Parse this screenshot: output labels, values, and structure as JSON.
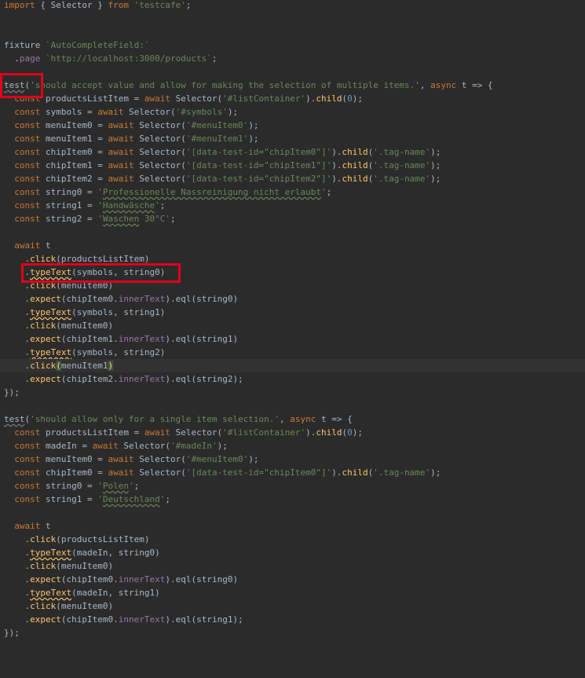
{
  "editor": {
    "language": "javascript",
    "background": "#2b2b2b",
    "lines": [
      [
        [
          "kw",
          "import"
        ],
        [
          "p",
          " { Selector } "
        ],
        [
          "kw",
          "from"
        ],
        [
          "p",
          " "
        ],
        [
          "str",
          "'testcafe'"
        ],
        [
          "p",
          ";"
        ]
      ],
      [],
      [],
      [
        [
          "p",
          "fixture "
        ],
        [
          "str",
          "`AutoCompleteField:`"
        ]
      ],
      [
        [
          "p",
          "  ."
        ],
        [
          "prop",
          "page"
        ],
        [
          "p",
          " "
        ],
        [
          "str",
          "`http://localhost:3000/products`"
        ],
        [
          "p",
          ";"
        ]
      ],
      [],
      [
        [
          "testname",
          "test"
        ],
        [
          "p",
          "("
        ],
        [
          "str",
          "'should accept value and allow for making the selection of multiple items.'"
        ],
        [
          "p",
          ", "
        ],
        [
          "kw",
          "async"
        ],
        [
          "p",
          " t => {"
        ]
      ],
      [
        [
          "p",
          "  "
        ],
        [
          "kw",
          "const"
        ],
        [
          "p",
          " productsListItem = "
        ],
        [
          "kw",
          "await"
        ],
        [
          "p",
          " Selector("
        ],
        [
          "str",
          "'#listContainer'"
        ],
        [
          "p",
          ")."
        ],
        [
          "method",
          "child"
        ],
        [
          "p",
          "("
        ],
        [
          "num",
          "0"
        ],
        [
          "p",
          ");"
        ]
      ],
      [
        [
          "p",
          "  "
        ],
        [
          "kw",
          "const"
        ],
        [
          "p",
          " symbols = "
        ],
        [
          "kw",
          "await"
        ],
        [
          "p",
          " Selector("
        ],
        [
          "str",
          "'#symbols'"
        ],
        [
          "p",
          ");"
        ]
      ],
      [
        [
          "p",
          "  "
        ],
        [
          "kw",
          "const"
        ],
        [
          "p",
          " menuItem0 = "
        ],
        [
          "kw",
          "await"
        ],
        [
          "p",
          " Selector("
        ],
        [
          "str",
          "'#menuItem0'"
        ],
        [
          "p",
          ");"
        ]
      ],
      [
        [
          "p",
          "  "
        ],
        [
          "kw",
          "const"
        ],
        [
          "p",
          " menuItem1 = "
        ],
        [
          "kw",
          "await"
        ],
        [
          "p",
          " Selector("
        ],
        [
          "str",
          "'#menuItem1'"
        ],
        [
          "p",
          ");"
        ]
      ],
      [
        [
          "p",
          "  "
        ],
        [
          "kw",
          "const"
        ],
        [
          "p",
          " chipItem0 = "
        ],
        [
          "kw",
          "await"
        ],
        [
          "p",
          " Selector("
        ],
        [
          "str",
          "'[data-test-id=\"chipItem0\"]'"
        ],
        [
          "p",
          ")."
        ],
        [
          "method",
          "child"
        ],
        [
          "p",
          "("
        ],
        [
          "str",
          "'.tag-name'"
        ],
        [
          "p",
          ");"
        ]
      ],
      [
        [
          "p",
          "  "
        ],
        [
          "kw",
          "const"
        ],
        [
          "p",
          " chipItem1 = "
        ],
        [
          "kw",
          "await"
        ],
        [
          "p",
          " Selector("
        ],
        [
          "str",
          "'[data-test-id=\"chipItem1\"]'"
        ],
        [
          "p",
          ")."
        ],
        [
          "method",
          "child"
        ],
        [
          "p",
          "("
        ],
        [
          "str",
          "'.tag-name'"
        ],
        [
          "p",
          ");"
        ]
      ],
      [
        [
          "p",
          "  "
        ],
        [
          "kw",
          "const"
        ],
        [
          "p",
          " chipItem2 = "
        ],
        [
          "kw",
          "await"
        ],
        [
          "p",
          " Selector("
        ],
        [
          "str",
          "'[data-test-id=\"chipItem2\"]'"
        ],
        [
          "p",
          ")."
        ],
        [
          "method",
          "child"
        ],
        [
          "p",
          "("
        ],
        [
          "str",
          "'.tag-name'"
        ],
        [
          "p",
          ");"
        ]
      ],
      [
        [
          "p",
          "  "
        ],
        [
          "kw",
          "const"
        ],
        [
          "p",
          " string0 = "
        ],
        [
          "str",
          "'"
        ],
        [
          "strU",
          "Professionelle Nassreinigung nicht erlaubt"
        ],
        [
          "str",
          "'"
        ],
        [
          "p",
          ";"
        ]
      ],
      [
        [
          "p",
          "  "
        ],
        [
          "kw",
          "const"
        ],
        [
          "p",
          " string1 = "
        ],
        [
          "str",
          "'"
        ],
        [
          "strU",
          "Handwäsche"
        ],
        [
          "str",
          "'"
        ],
        [
          "p",
          ";"
        ]
      ],
      [
        [
          "p",
          "  "
        ],
        [
          "kw",
          "const"
        ],
        [
          "p",
          " string2 = "
        ],
        [
          "str",
          "'"
        ],
        [
          "strU",
          "Waschen"
        ],
        [
          "str",
          " 30°C'"
        ],
        [
          "p",
          ";"
        ]
      ],
      [],
      [
        [
          "p",
          "  "
        ],
        [
          "kw",
          "await"
        ],
        [
          "p",
          " t"
        ]
      ],
      [
        [
          "p",
          "    ."
        ],
        [
          "method",
          "click"
        ],
        [
          "p",
          "(productsListItem)"
        ]
      ],
      [
        [
          "p",
          "    ."
        ],
        [
          "methodU",
          "typeText"
        ],
        [
          "p",
          "(symbols, string0)"
        ]
      ],
      [
        [
          "p",
          "    ."
        ],
        [
          "method",
          "click"
        ],
        [
          "p",
          "(menuItem0)"
        ]
      ],
      [
        [
          "p",
          "    ."
        ],
        [
          "method",
          "expect"
        ],
        [
          "p",
          "(chipItem0."
        ],
        [
          "prop",
          "innerText"
        ],
        [
          "p",
          ")."
        ],
        [
          "p",
          "eql(string0)"
        ]
      ],
      [
        [
          "p",
          "    ."
        ],
        [
          "methodU",
          "typeText"
        ],
        [
          "p",
          "(symbols, string1)"
        ]
      ],
      [
        [
          "p",
          "    ."
        ],
        [
          "method",
          "click"
        ],
        [
          "p",
          "(menuItem0)"
        ]
      ],
      [
        [
          "p",
          "    ."
        ],
        [
          "method",
          "expect"
        ],
        [
          "p",
          "(chipItem1."
        ],
        [
          "prop",
          "innerText"
        ],
        [
          "p",
          ")."
        ],
        [
          "p",
          "eql(string1)"
        ]
      ],
      [
        [
          "p",
          "    ."
        ],
        [
          "methodU",
          "typeText"
        ],
        [
          "p",
          "(symbols, string2)"
        ]
      ],
      [
        [
          "p",
          "    ."
        ],
        [
          "method",
          "click"
        ],
        [
          "bm",
          "("
        ],
        [
          "p",
          "menuItem1"
        ],
        [
          "bm",
          ")"
        ]
      ],
      [
        [
          "p",
          "    ."
        ],
        [
          "method",
          "expect"
        ],
        [
          "p",
          "(chipItem2."
        ],
        [
          "prop",
          "innerText"
        ],
        [
          "p",
          ")."
        ],
        [
          "p",
          "eql(string2);"
        ]
      ],
      [
        [
          "p",
          "});"
        ]
      ],
      [],
      [
        [
          "testname",
          "test"
        ],
        [
          "p",
          "("
        ],
        [
          "str",
          "'should allow only for a single item selection.'"
        ],
        [
          "p",
          ", "
        ],
        [
          "kw",
          "async"
        ],
        [
          "p",
          " t => {"
        ]
      ],
      [
        [
          "p",
          "  "
        ],
        [
          "kw",
          "const"
        ],
        [
          "p",
          " productsListItem = "
        ],
        [
          "kw",
          "await"
        ],
        [
          "p",
          " Selector("
        ],
        [
          "str",
          "'#listContainer'"
        ],
        [
          "p",
          ")."
        ],
        [
          "method",
          "child"
        ],
        [
          "p",
          "("
        ],
        [
          "num",
          "0"
        ],
        [
          "p",
          ");"
        ]
      ],
      [
        [
          "p",
          "  "
        ],
        [
          "kw",
          "const"
        ],
        [
          "p",
          " madeIn = "
        ],
        [
          "kw",
          "await"
        ],
        [
          "p",
          " Selector("
        ],
        [
          "str",
          "'#madeIn'"
        ],
        [
          "p",
          ");"
        ]
      ],
      [
        [
          "p",
          "  "
        ],
        [
          "kw",
          "const"
        ],
        [
          "p",
          " menuItem0 = "
        ],
        [
          "kw",
          "await"
        ],
        [
          "p",
          " Selector("
        ],
        [
          "str",
          "'#menuItem0'"
        ],
        [
          "p",
          ");"
        ]
      ],
      [
        [
          "p",
          "  "
        ],
        [
          "kw",
          "const"
        ],
        [
          "p",
          " chipItem0 = "
        ],
        [
          "kw",
          "await"
        ],
        [
          "p",
          " Selector("
        ],
        [
          "str",
          "'[data-test-id=\"chipItem0\"]'"
        ],
        [
          "p",
          ")."
        ],
        [
          "method",
          "child"
        ],
        [
          "p",
          "("
        ],
        [
          "str",
          "'.tag-name'"
        ],
        [
          "p",
          ");"
        ]
      ],
      [
        [
          "p",
          "  "
        ],
        [
          "kw",
          "const"
        ],
        [
          "p",
          " string0 = "
        ],
        [
          "str",
          "'"
        ],
        [
          "strU",
          "Polen"
        ],
        [
          "str",
          "'"
        ],
        [
          "p",
          ";"
        ]
      ],
      [
        [
          "p",
          "  "
        ],
        [
          "kw",
          "const"
        ],
        [
          "p",
          " string1 = "
        ],
        [
          "str",
          "'"
        ],
        [
          "strU",
          "Deutschland"
        ],
        [
          "str",
          "'"
        ],
        [
          "p",
          ";"
        ]
      ],
      [],
      [
        [
          "p",
          "  "
        ],
        [
          "kw",
          "await"
        ],
        [
          "p",
          " t"
        ]
      ],
      [
        [
          "p",
          "    ."
        ],
        [
          "method",
          "click"
        ],
        [
          "p",
          "(productsListItem)"
        ]
      ],
      [
        [
          "p",
          "    ."
        ],
        [
          "methodU",
          "typeText"
        ],
        [
          "p",
          "(madeIn, string0)"
        ]
      ],
      [
        [
          "p",
          "    ."
        ],
        [
          "method",
          "click"
        ],
        [
          "p",
          "(menuItem0)"
        ]
      ],
      [
        [
          "p",
          "    ."
        ],
        [
          "method",
          "expect"
        ],
        [
          "p",
          "(chipItem0."
        ],
        [
          "prop",
          "innerText"
        ],
        [
          "p",
          ")."
        ],
        [
          "p",
          "eql(string0)"
        ]
      ],
      [
        [
          "p",
          "    ."
        ],
        [
          "methodU",
          "typeText"
        ],
        [
          "p",
          "(madeIn, string1)"
        ]
      ],
      [
        [
          "p",
          "    ."
        ],
        [
          "method",
          "click"
        ],
        [
          "p",
          "(menuItem0)"
        ]
      ],
      [
        [
          "p",
          "    ."
        ],
        [
          "method",
          "expect"
        ],
        [
          "p",
          "(chipItem0."
        ],
        [
          "prop",
          "innerText"
        ],
        [
          "p",
          ")."
        ],
        [
          "p",
          "eql(string1);"
        ]
      ],
      [
        [
          "p",
          "});"
        ]
      ]
    ],
    "current_line_index": 27,
    "highlights": [
      {
        "line_index": 6,
        "label": "test-keyword-highlight"
      },
      {
        "line_index": 20,
        "label": "typetext-call-highlight"
      }
    ]
  }
}
